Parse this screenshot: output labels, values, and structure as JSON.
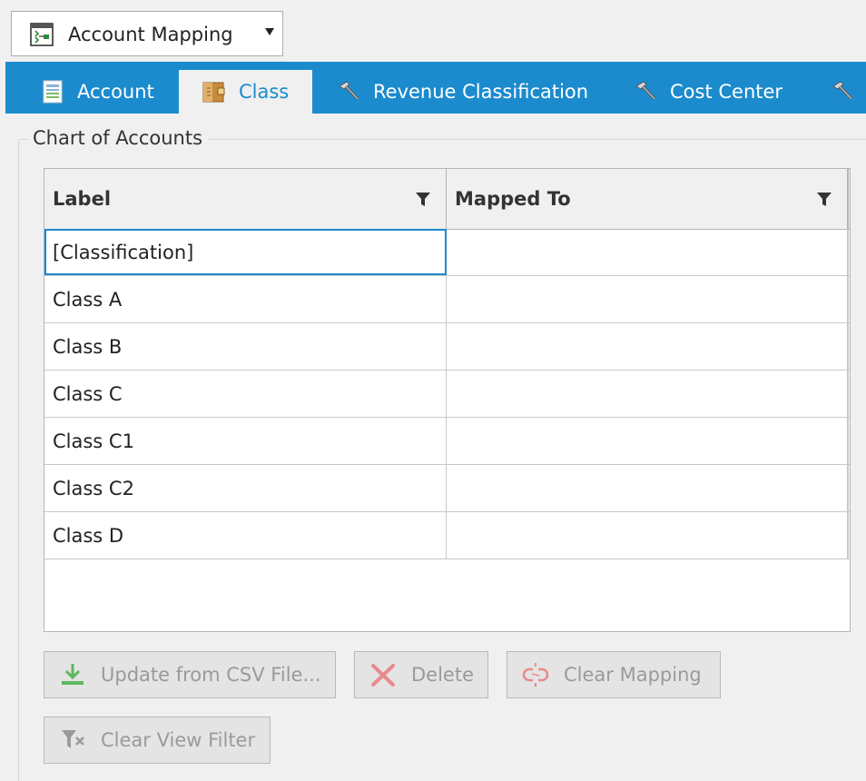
{
  "selector": {
    "value": "Account Mapping"
  },
  "tabs": [
    {
      "label": "Account",
      "icon": "account-sheet-icon"
    },
    {
      "label": "Class",
      "icon": "class-folder-icon",
      "active": true
    },
    {
      "label": "Revenue Classification",
      "icon": "hammer-icon"
    },
    {
      "label": "Cost Center",
      "icon": "hammer-icon"
    }
  ],
  "group": {
    "title": "Chart of Accounts"
  },
  "grid": {
    "columns": [
      "Label",
      "Mapped To"
    ],
    "rows": [
      {
        "label": "[Classification]",
        "mapped": ""
      },
      {
        "label": "Class A",
        "mapped": ""
      },
      {
        "label": "Class B",
        "mapped": ""
      },
      {
        "label": "Class C",
        "mapped": ""
      },
      {
        "label": "Class C1",
        "mapped": ""
      },
      {
        "label": "Class C2",
        "mapped": ""
      },
      {
        "label": "Class D",
        "mapped": ""
      }
    ],
    "selected_row": 0
  },
  "buttons": {
    "update_csv": "Update from CSV File...",
    "delete": "Delete",
    "clear_mapping": "Clear Mapping",
    "clear_view_filter": "Clear View Filter"
  },
  "colors": {
    "accent": "#1b8bce",
    "background": "#f0f0f0",
    "disabled_text": "#9a9a9a"
  }
}
